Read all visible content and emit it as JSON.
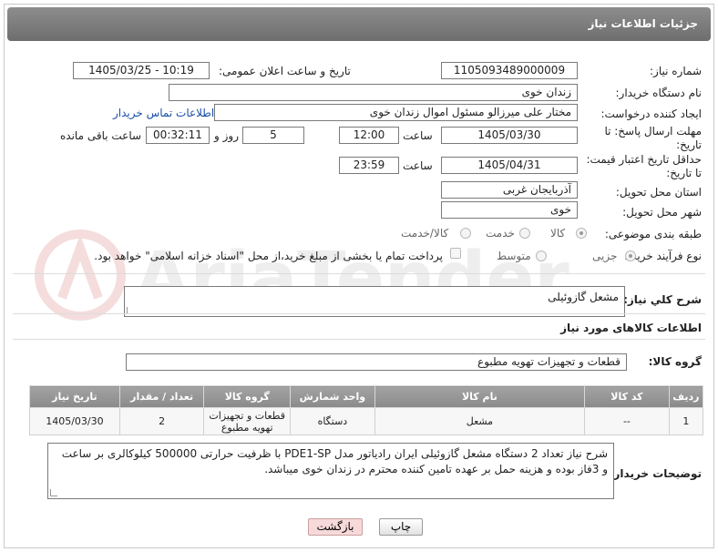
{
  "header": {
    "title": "جزئیات اطلاعات نیاز"
  },
  "fields": {
    "need_number_label": "شماره نیاز:",
    "need_number": "1105093489000009",
    "announce_label": "تاریخ و ساعت اعلان عمومی:",
    "announce_value": "1405/03/25 - 10:19",
    "buyer_org_label": "نام دستگاه خریدار:",
    "buyer_org": "زندان خوی",
    "requester_label": "ایجاد کننده درخواست:",
    "requester": "مختار علی میرزالو مسئول اموال زندان خوی",
    "contact_link": "اطلاعات تماس خریدار",
    "deadline_label_1": "مهلت ارسال پاسخ: تا",
    "deadline_label_2": "تاریخ:",
    "deadline_date": "1405/03/30",
    "time_label": "ساعت",
    "deadline_time": "12:00",
    "days_value": "5",
    "days_label": "روز و",
    "remaining_time": "00:32:11",
    "remaining_label": "ساعت باقی مانده",
    "price_valid_label_1": "حداقل تاریخ اعتبار قیمت:",
    "price_valid_label_2": "تا تاریخ:",
    "price_valid_date": "1405/04/31",
    "price_valid_time_label": "ساعت",
    "price_valid_time": "23:59",
    "province_label": "استان محل تحویل:",
    "province": "آذربایجان غربی",
    "city_label": "شهر محل تحویل:",
    "city": "خوی",
    "category_label": "طبقه بندی موضوعی:",
    "category_options": [
      "کالا",
      "خدمت",
      "کالا/خدمت"
    ],
    "process_label": "نوع فرآیند خرید :",
    "process_options": [
      "جزیی",
      "متوسط"
    ],
    "payment_note": "پرداخت تمام یا بخشی از مبلغ خرید،از محل \"اسناد خزانه اسلامی\" خواهد بود."
  },
  "summary": {
    "label": "شرح کلي نياز:",
    "value": "مشعل گازوئیلی"
  },
  "goods_section": {
    "title": "اطلاعات کالاهای مورد نیاز",
    "group_label": "گروه کالا:",
    "group_value": "قطعات و تجهیزات تهویه مطبوع"
  },
  "table": {
    "headers": [
      "ردیف",
      "کد کالا",
      "نام کالا",
      "واحد شمارش",
      "گروه کالا",
      "تعداد / مقدار",
      "تاریخ نیاز"
    ],
    "rows": [
      [
        "1",
        "--",
        "مشعل",
        "دستگاه",
        "قطعات و تجهیزات تهویه مطبوع",
        "2",
        "1405/03/30"
      ]
    ]
  },
  "buyer_notes": {
    "label": "توضیحات خریدار:",
    "value": "شرح نیاز تعداد 2 دستگاه مشعل گازوئیلی ایران رادیاتور مدل PDE1-SP با ظرفیت حرارتی 500000 کیلوکالری بر ساعت و 3فاز بوده و هزینه حمل بر عهده تامین کننده محترم در زندان خوی میباشد."
  },
  "buttons": {
    "print": "چاپ",
    "back": "بازگشت"
  },
  "watermark": {
    "text": "AriaTender.neT"
  },
  "colors": {
    "header_bg": "#7d7d7d",
    "link": "#1a4fa6",
    "back_button": "#f7d9d9"
  }
}
